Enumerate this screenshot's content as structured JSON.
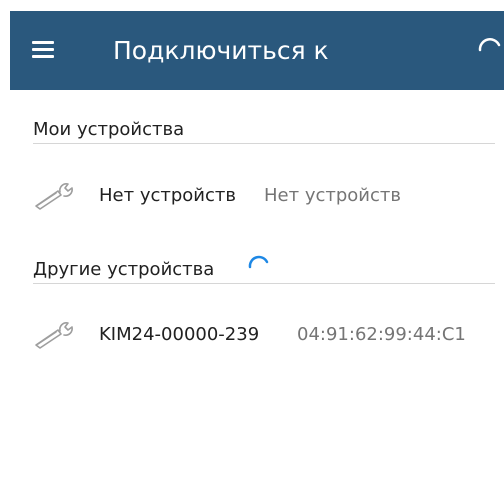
{
  "appbar": {
    "title": "Подключиться к",
    "menu_icon": "hamburger-menu-icon",
    "spinner_icon": "loading-spinner-icon",
    "color": "#2a587d"
  },
  "sections": {
    "my_devices": {
      "header": "Мои устройства",
      "items": [
        {
          "icon": "wrench-icon",
          "name": "Нет устройств",
          "address": "Нет устройств"
        }
      ]
    },
    "other_devices": {
      "header": "Другие устройства",
      "spinner_icon": "loading-spinner-icon",
      "items": [
        {
          "icon": "wrench-icon",
          "name": "KIM24-00000-239",
          "address": "04:91:62:99:44:C1"
        }
      ]
    }
  }
}
